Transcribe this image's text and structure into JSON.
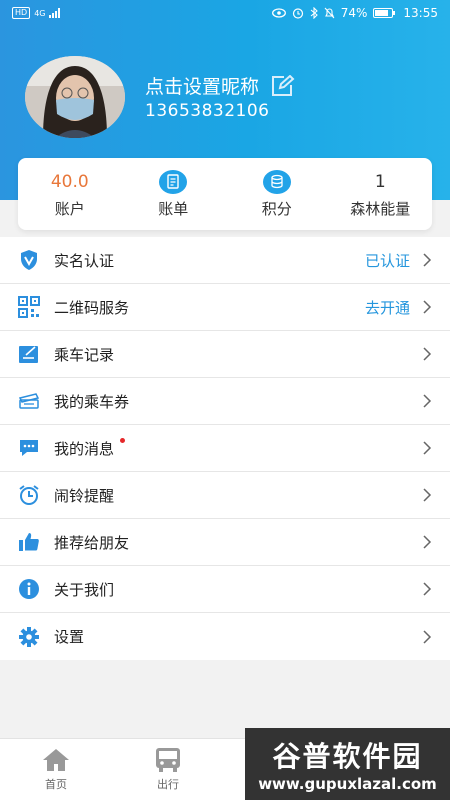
{
  "status_bar": {
    "network": "4G",
    "hd": "HD",
    "battery": "74%",
    "time": "13:55"
  },
  "profile": {
    "nickname": "点击设置昵称",
    "phone": "13653832106"
  },
  "stats": [
    {
      "value": "40.0",
      "label": "账户"
    },
    {
      "icon": "bill-icon",
      "label": "账单"
    },
    {
      "icon": "points-icon",
      "label": "积分"
    },
    {
      "value": "1",
      "label": "森林能量"
    }
  ],
  "menu": [
    {
      "label": "实名认证",
      "icon": "shield-v-icon",
      "status": "已认证"
    },
    {
      "label": "二维码服务",
      "icon": "qrcode-icon",
      "status": "去开通"
    },
    {
      "label": "乘车记录",
      "icon": "record-icon"
    },
    {
      "label": "我的乘车券",
      "icon": "ticket-icon"
    },
    {
      "label": "我的消息",
      "icon": "message-icon",
      "unread": true
    },
    {
      "label": "闹铃提醒",
      "icon": "alarm-icon"
    },
    {
      "label": "推荐给朋友",
      "icon": "thumbs-up-icon"
    },
    {
      "label": "关于我们",
      "icon": "info-icon"
    },
    {
      "label": "设置",
      "icon": "gear-icon"
    }
  ],
  "tabbar": [
    {
      "label": "首页",
      "icon": "home-icon"
    },
    {
      "label": "出行",
      "icon": "bus-icon"
    }
  ],
  "watermark": {
    "title": "谷普软件园",
    "url": "www.gupuxlazal.com"
  },
  "colors": {
    "header": "#1ea2e4",
    "accent": "#2596dd",
    "balance": "#e8773a",
    "unread_dot": "#e5282a"
  }
}
